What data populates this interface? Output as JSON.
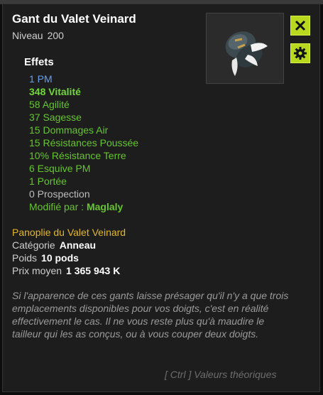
{
  "item": {
    "name": "Gant du Valet Veinard",
    "level_label": "Niveau",
    "level_value": "200"
  },
  "effects_title": "Effets",
  "effects": [
    {
      "text": "1 PM",
      "style": "pm"
    },
    {
      "text": "348 Vitalité",
      "style": "green-bold"
    },
    {
      "text": "58 Agilité",
      "style": "green"
    },
    {
      "text": "37 Sagesse",
      "style": "green"
    },
    {
      "text": "15 Dommages Air",
      "style": "green"
    },
    {
      "text": "15 Résistances Poussée",
      "style": "green"
    },
    {
      "text": "10% Résistance Terre",
      "style": "green"
    },
    {
      "text": "6 Esquive PM",
      "style": "green"
    },
    {
      "text": "1 Portée",
      "style": "green"
    },
    {
      "text": "0 Prospection",
      "style": "grey"
    }
  ],
  "modified_by": {
    "label": "Modifié par :",
    "name": "Maglaly"
  },
  "set": {
    "name": "Panoplie du Valet Veinard"
  },
  "info": {
    "category_label": "Catégorie",
    "category_value": "Anneau",
    "weight_label": "Poids",
    "weight_value": "10 pods",
    "price_label": "Prix moyen",
    "price_value": "1 365 943 K"
  },
  "description": "Si l'apparence de ces gants laisse présager qu'il n'y a que trois emplacements disponibles pour vos doigts, c'est en réalité effectivement le cas. Il ne vous reste plus qu'à maudire le tailleur qui les as conçus, ou à vous couper deux doigts.",
  "footer": "[ Ctrl ] Valeurs théoriques",
  "icons": {
    "close": "close-icon",
    "settings": "gear-icon",
    "item": "glove-item-icon"
  },
  "colors": {
    "accent_button": "#b8d820",
    "effect_green": "#66c52e",
    "effect_pm": "#6a9ee8",
    "set_gold": "#e2b72a"
  }
}
